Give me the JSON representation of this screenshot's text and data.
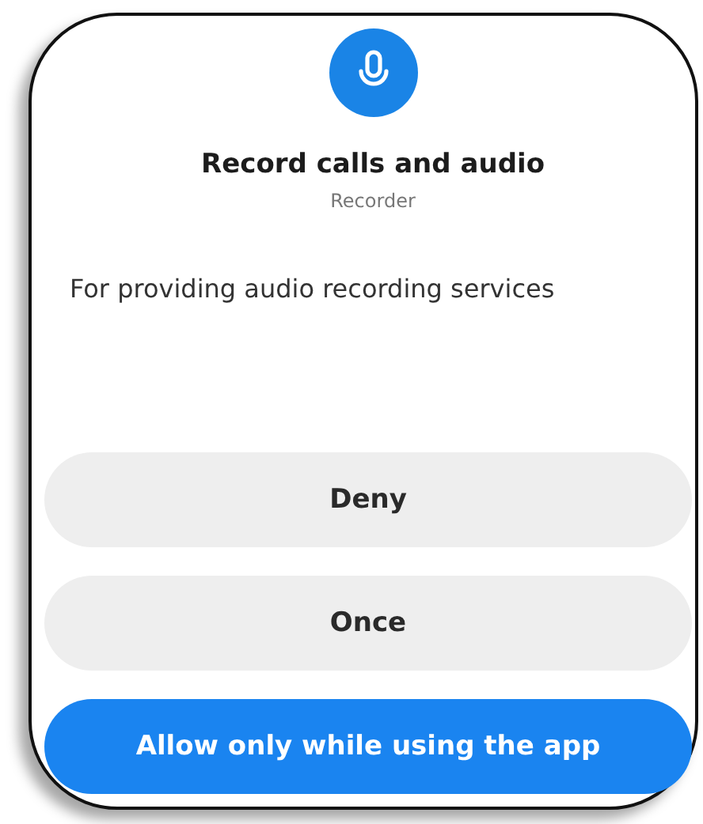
{
  "dialog": {
    "title": "Record calls and audio",
    "app_name": "Recorder",
    "description": "For providing audio recording services",
    "buttons": [
      {
        "label": "Deny",
        "kind": "secondary"
      },
      {
        "label": "Once",
        "kind": "secondary"
      },
      {
        "label": "Allow only while using the app",
        "kind": "primary"
      }
    ]
  }
}
